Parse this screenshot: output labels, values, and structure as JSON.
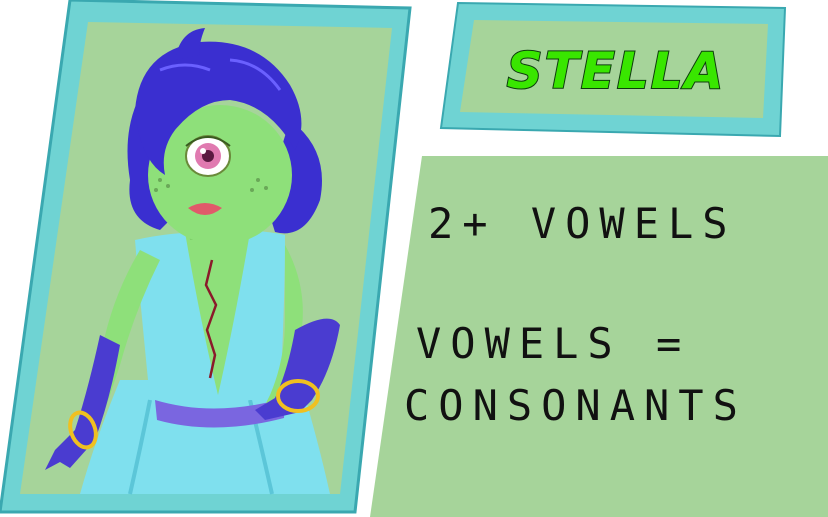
{
  "character": {
    "name": "STELLA",
    "name_color": "#39e600",
    "name_outline": "#0d3b0d"
  },
  "rules": {
    "line1": "2+ VOWELS",
    "line2": "VOWELS =",
    "line3": "CONSONANTS"
  },
  "colors": {
    "card_fill": "#a6d49a",
    "card_border": "#6fd3d3",
    "card_border_dark": "#3aa8b0",
    "skin": "#8ee07a",
    "hair": "#3a2fd0",
    "dress": "#7fe0ee",
    "belt": "#7a66e0",
    "gloves": "#4a3cd0",
    "eye": "#e07ab0",
    "lips": "#e05a6a",
    "bracelet": "#f0c020"
  }
}
